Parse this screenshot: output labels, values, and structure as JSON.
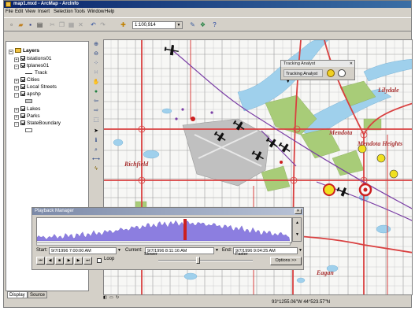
{
  "window": {
    "title": "map1.mxd - ArcMap - ArcInfo"
  },
  "menu": [
    "File",
    "Edit",
    "View",
    "Insert",
    "Selection",
    "Tools",
    "Window",
    "Help"
  ],
  "toolbar": {
    "scale": "1:100,914"
  },
  "toc": {
    "root": "Layers",
    "layers": [
      {
        "name": "tstations01",
        "checked": true,
        "expanded": true
      },
      {
        "name": "tplanes01",
        "checked": true,
        "expanded": false
      },
      {
        "legend": "Track"
      },
      {
        "name": "Cities",
        "checked": true,
        "expanded": true
      },
      {
        "name": "Local Streets",
        "checked": true,
        "expanded": true
      },
      {
        "name": "apshp",
        "checked": true,
        "expanded": false
      },
      {
        "name": "Lakes",
        "checked": true,
        "expanded": true
      },
      {
        "name": "Parks",
        "checked": true,
        "expanded": true
      },
      {
        "name": "StateBoundary",
        "checked": true,
        "expanded": false
      }
    ],
    "tabs": [
      "Display",
      "Source"
    ]
  },
  "map": {
    "labels": {
      "lilydale": "Lilydale",
      "mendota": "Mendota",
      "mendota_heights": "Mendota Heights",
      "richfield": "Richfield",
      "eagan": "Eagan"
    }
  },
  "tracking_analyst": {
    "title": "Tracking Analyst",
    "dropdown": "Tracking Analyst ▼"
  },
  "playback": {
    "title": "Playback Manager",
    "start_label": "Start:",
    "start": "9/7/1996 7:00:00 AM",
    "current_label": "Current:",
    "current": "9/7/1996 8:11:16 AM",
    "end_label": "End:",
    "end": "9/7/1996 9:04:25 AM",
    "loop_label": "Loop",
    "slower_label": "Slower",
    "faster_label": "Faster",
    "options_label": "Options >>"
  },
  "status": {
    "coords": "93°1255.06\"W  44°523.57\"N"
  },
  "colors": {
    "track": "#7b3fa6",
    "roads": "#d94040",
    "water": "#9fd0ec",
    "parks": "#a8cc78",
    "airport": "#c0c0c0",
    "histogram": "#8c7ee0",
    "current_marker": "#cc2020"
  }
}
